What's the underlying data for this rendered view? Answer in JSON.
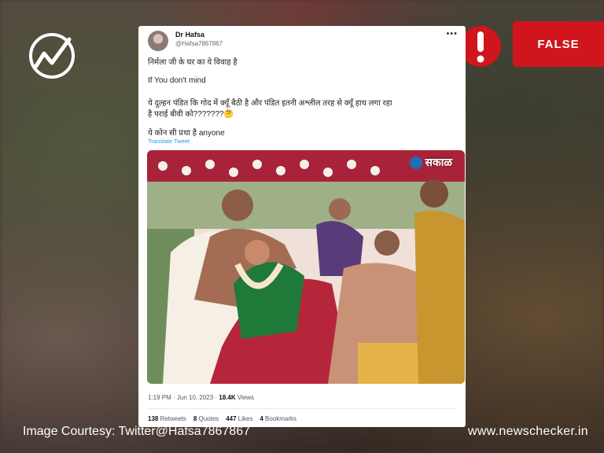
{
  "verdict": {
    "label": "FALSE",
    "color": "#d0151c"
  },
  "tweet": {
    "author_name": "Dr Hafsa",
    "handle": "@Hafsa7867867",
    "menu": "•••",
    "line1": "निर्मला जी के घर का ये विवाह है",
    "line2": "If You don't mind",
    "line3": "ये दुल्हन  पंडित कि गोद में क्यूँ बैठी है और पंडित इतनी अश्लील तरह से क्यूँ हाथ लगा रहा",
    "line4": "है पराई बीवी को???????🤔",
    "line5": "ये कोन सी प्रथा है anyone",
    "translate": "Translate Tweet",
    "time": "1:19 PM · Jun 10, 2023 · ",
    "views_count": "18.4K",
    "views_label": " Views",
    "retweets_count": "138",
    "retweets_label": " Retweets",
    "quotes_count": "8",
    "quotes_label": " Quotes",
    "likes_count": "447",
    "likes_label": " Likes",
    "bookmarks_count": "4",
    "bookmarks_label": " Bookmarks"
  },
  "photo": {
    "watermark": "सकाळ"
  },
  "footer": {
    "courtesy": "Image Courtesy: Twitter@Hafsa7867867",
    "site": "www.newschecker.in"
  },
  "icons": [
    "newschecker-logo-icon",
    "exclamation-icon",
    "watermark-logo-icon"
  ]
}
